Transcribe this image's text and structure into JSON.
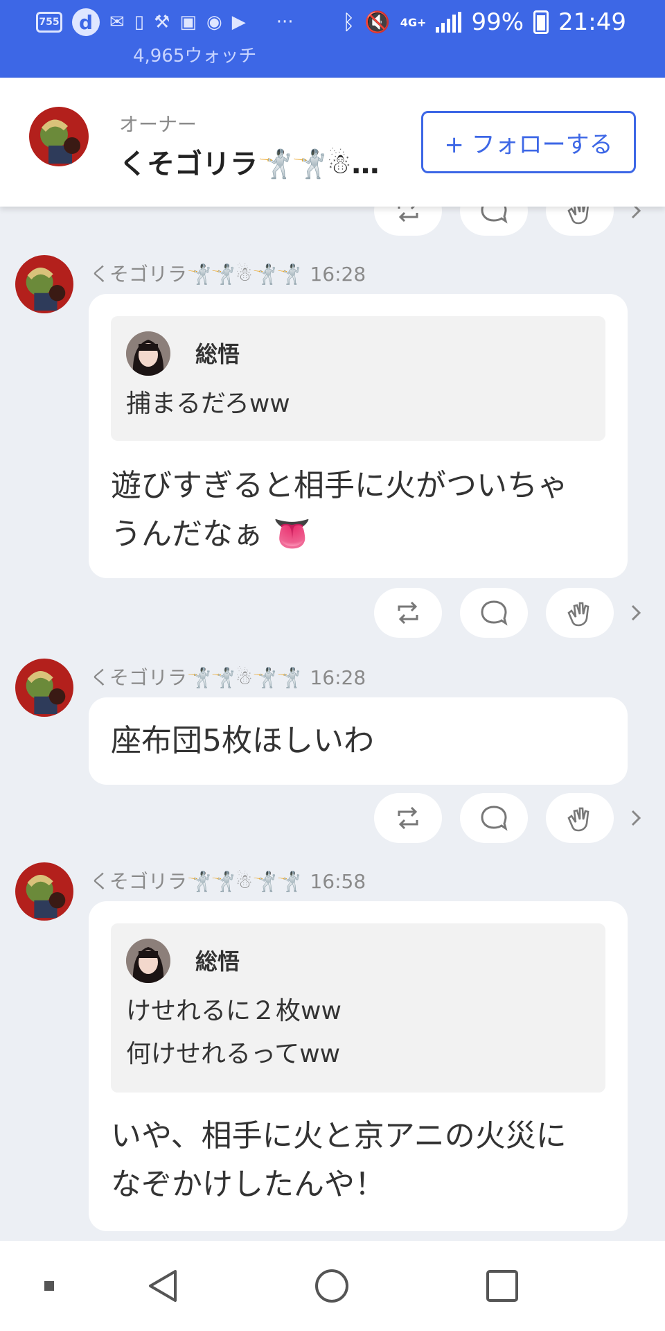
{
  "status_bar": {
    "icon_names": [
      "755-app-icon",
      "d-app-icon",
      "mail-icon",
      "battery-saver-icon",
      "tool-icon",
      "image-icon",
      "android-icon",
      "youtube-icon",
      "more-icon",
      "bluetooth-icon",
      "mute-icon",
      "4g-icon",
      "signal-icon",
      "battery-icon"
    ],
    "more": "···",
    "network": "4G+",
    "battery": "99%",
    "time": "21:49",
    "watch_count": "4,965ウォッチ"
  },
  "owner": {
    "label": "オーナー",
    "name": "くそゴリラ🤺🤺☃…",
    "follow_label": "+ フォローする"
  },
  "posts": [
    {
      "author": "くそゴリラ🤺🤺☃🤺🤺",
      "time": "16:28",
      "quote": {
        "name": "総悟",
        "text": "捕まるだろww"
      },
      "text": "遊びすぎると相手に火がついちゃ\nうんだなぁ 👅"
    },
    {
      "author": "くそゴリラ🤺🤺☃🤺🤺",
      "time": "16:28",
      "text": "座布団5枚ほしいわ"
    },
    {
      "author": "くそゴリラ🤺🤺☃🤺🤺",
      "time": "16:58",
      "quote": {
        "name": "総悟",
        "text": "けせれるに２枚ww\n何けせれるってww"
      },
      "text": "いや、相手に火と京アニの火災に\nなぞかけしたんや！"
    }
  ],
  "colors": {
    "accent": "#3d67e6",
    "background": "#eceff4"
  }
}
